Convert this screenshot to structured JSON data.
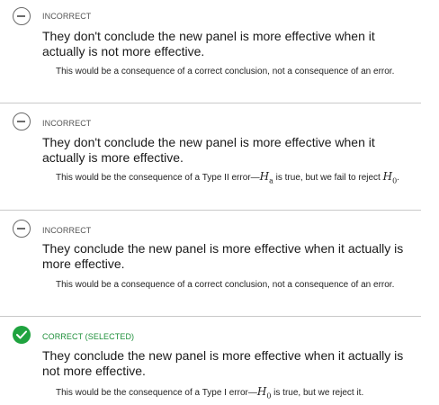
{
  "options": [
    {
      "status": "INCORRECT",
      "answer": "They don't conclude the new panel is more effective when it actually is not more effective.",
      "explanation": "This would be a consequence of a correct conclusion, not a consequence of an error."
    },
    {
      "status": "INCORRECT",
      "answer": "They don't conclude the new panel is more effective when it actually is more effective.",
      "explanation_pre": "This would be the consequence of a Type II error—",
      "explanation_var1": "H",
      "explanation_sub1": "a",
      "explanation_mid": " is true, but we fail to reject ",
      "explanation_var2": "H",
      "explanation_sub2": "0",
      "explanation_post": "."
    },
    {
      "status": "INCORRECT",
      "answer": "They conclude the new panel is more effective when it actually is more effective.",
      "explanation": "This would be a consequence of a correct conclusion, not a consequence of an error."
    },
    {
      "status": "CORRECT (SELECTED)",
      "answer": "They conclude the new panel is more effective when it actually is not more effective.",
      "explanation_pre": "This would be the consequence of a Type I error—",
      "explanation_var1": "H",
      "explanation_sub1": "0",
      "explanation_post": " is true, but we reject it."
    }
  ],
  "colors": {
    "correct": "#1fa33f",
    "incorrect_icon": "#6b6b6b",
    "divider": "#c9c9c9"
  },
  "icons": {
    "incorrect": "minus-circle-icon",
    "correct": "checkmark-circle-icon"
  }
}
